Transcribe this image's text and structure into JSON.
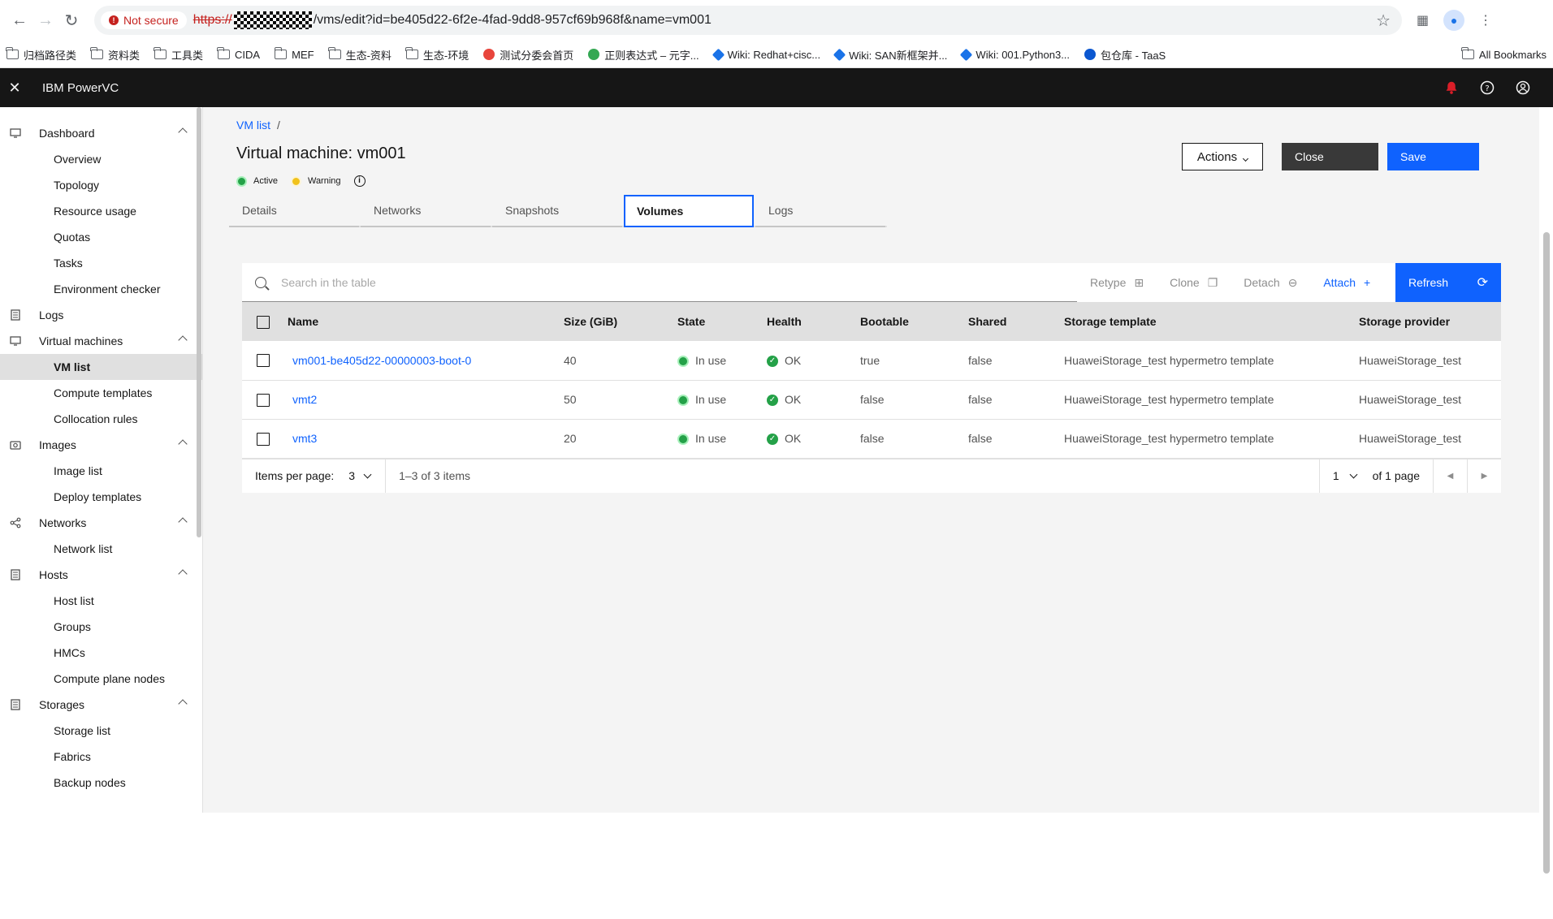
{
  "browser": {
    "security_label": "Not secure",
    "url_scheme": "https://",
    "url_rest": "/vms/edit?id=be405d22-6f2e-4fad-9dd8-957cf69b968f&name=vm001",
    "bookmarks": [
      "归档路径类",
      "资料类",
      "工具类",
      "CIDA",
      "MEF",
      "生态-资料",
      "生态-环境",
      "测试分委会首页",
      "正则表达式 – 元字...",
      "Wiki: Redhat+cisc...",
      "Wiki: SAN新框架并...",
      "Wiki: 001.Python3...",
      "包仓库 - TaaS"
    ],
    "all_bookmarks": "All Bookmarks"
  },
  "app": {
    "brand": "IBM PowerVC"
  },
  "sidebar": {
    "groups": [
      {
        "label": "Dashboard",
        "items": [
          "Overview",
          "Topology",
          "Resource usage",
          "Quotas",
          "Tasks",
          "Environment checker"
        ]
      },
      {
        "label": "Logs",
        "items": []
      },
      {
        "label": "Virtual machines",
        "items": [
          "VM list",
          "Compute templates",
          "Collocation rules"
        ]
      },
      {
        "label": "Images",
        "items": [
          "Image list",
          "Deploy templates"
        ]
      },
      {
        "label": "Networks",
        "items": [
          "Network list"
        ]
      },
      {
        "label": "Hosts",
        "items": [
          "Host list",
          "Groups",
          "HMCs",
          "Compute plane nodes"
        ]
      },
      {
        "label": "Storages",
        "items": [
          "Storage list",
          "Fabrics",
          "Backup nodes"
        ]
      }
    ]
  },
  "page": {
    "breadcrumb": "VM list",
    "breadcrumb_sep": "/",
    "title": "Virtual machine: vm001",
    "status_active": "Active",
    "status_warning": "Warning",
    "actions_label": "Actions",
    "close_label": "Close",
    "save_label": "Save",
    "tabs": [
      "Details",
      "Networks",
      "Snapshots",
      "Volumes",
      "Logs"
    ]
  },
  "colors": {
    "active": "#24a148",
    "warning": "#f1c21b",
    "primary": "#0f62fe"
  },
  "table": {
    "search_placeholder": "Search in the table",
    "toolbar": {
      "retype": "Retype",
      "clone": "Clone",
      "detach": "Detach",
      "attach": "Attach",
      "refresh": "Refresh"
    },
    "columns": [
      "Name",
      "Size (GiB)",
      "State",
      "Health",
      "Bootable",
      "Shared",
      "Storage template",
      "Storage provider"
    ],
    "rows": [
      {
        "name": "vm001-be405d22-00000003-boot-0",
        "size": "40",
        "state": "In use",
        "health": "OK",
        "bootable": "true",
        "shared": "false",
        "template": "HuaweiStorage_test hypermetro template",
        "provider": "HuaweiStorage_test"
      },
      {
        "name": "vmt2",
        "size": "50",
        "state": "In use",
        "health": "OK",
        "bootable": "false",
        "shared": "false",
        "template": "HuaweiStorage_test hypermetro template",
        "provider": "HuaweiStorage_test"
      },
      {
        "name": "vmt3",
        "size": "20",
        "state": "In use",
        "health": "OK",
        "bootable": "false",
        "shared": "false",
        "template": "HuaweiStorage_test hypermetro template",
        "provider": "HuaweiStorage_test"
      }
    ],
    "pager": {
      "items_label": "Items per page:",
      "items_value": "3",
      "range": "1–3 of 3 items",
      "page_value": "1",
      "page_of": "of 1 page"
    }
  }
}
